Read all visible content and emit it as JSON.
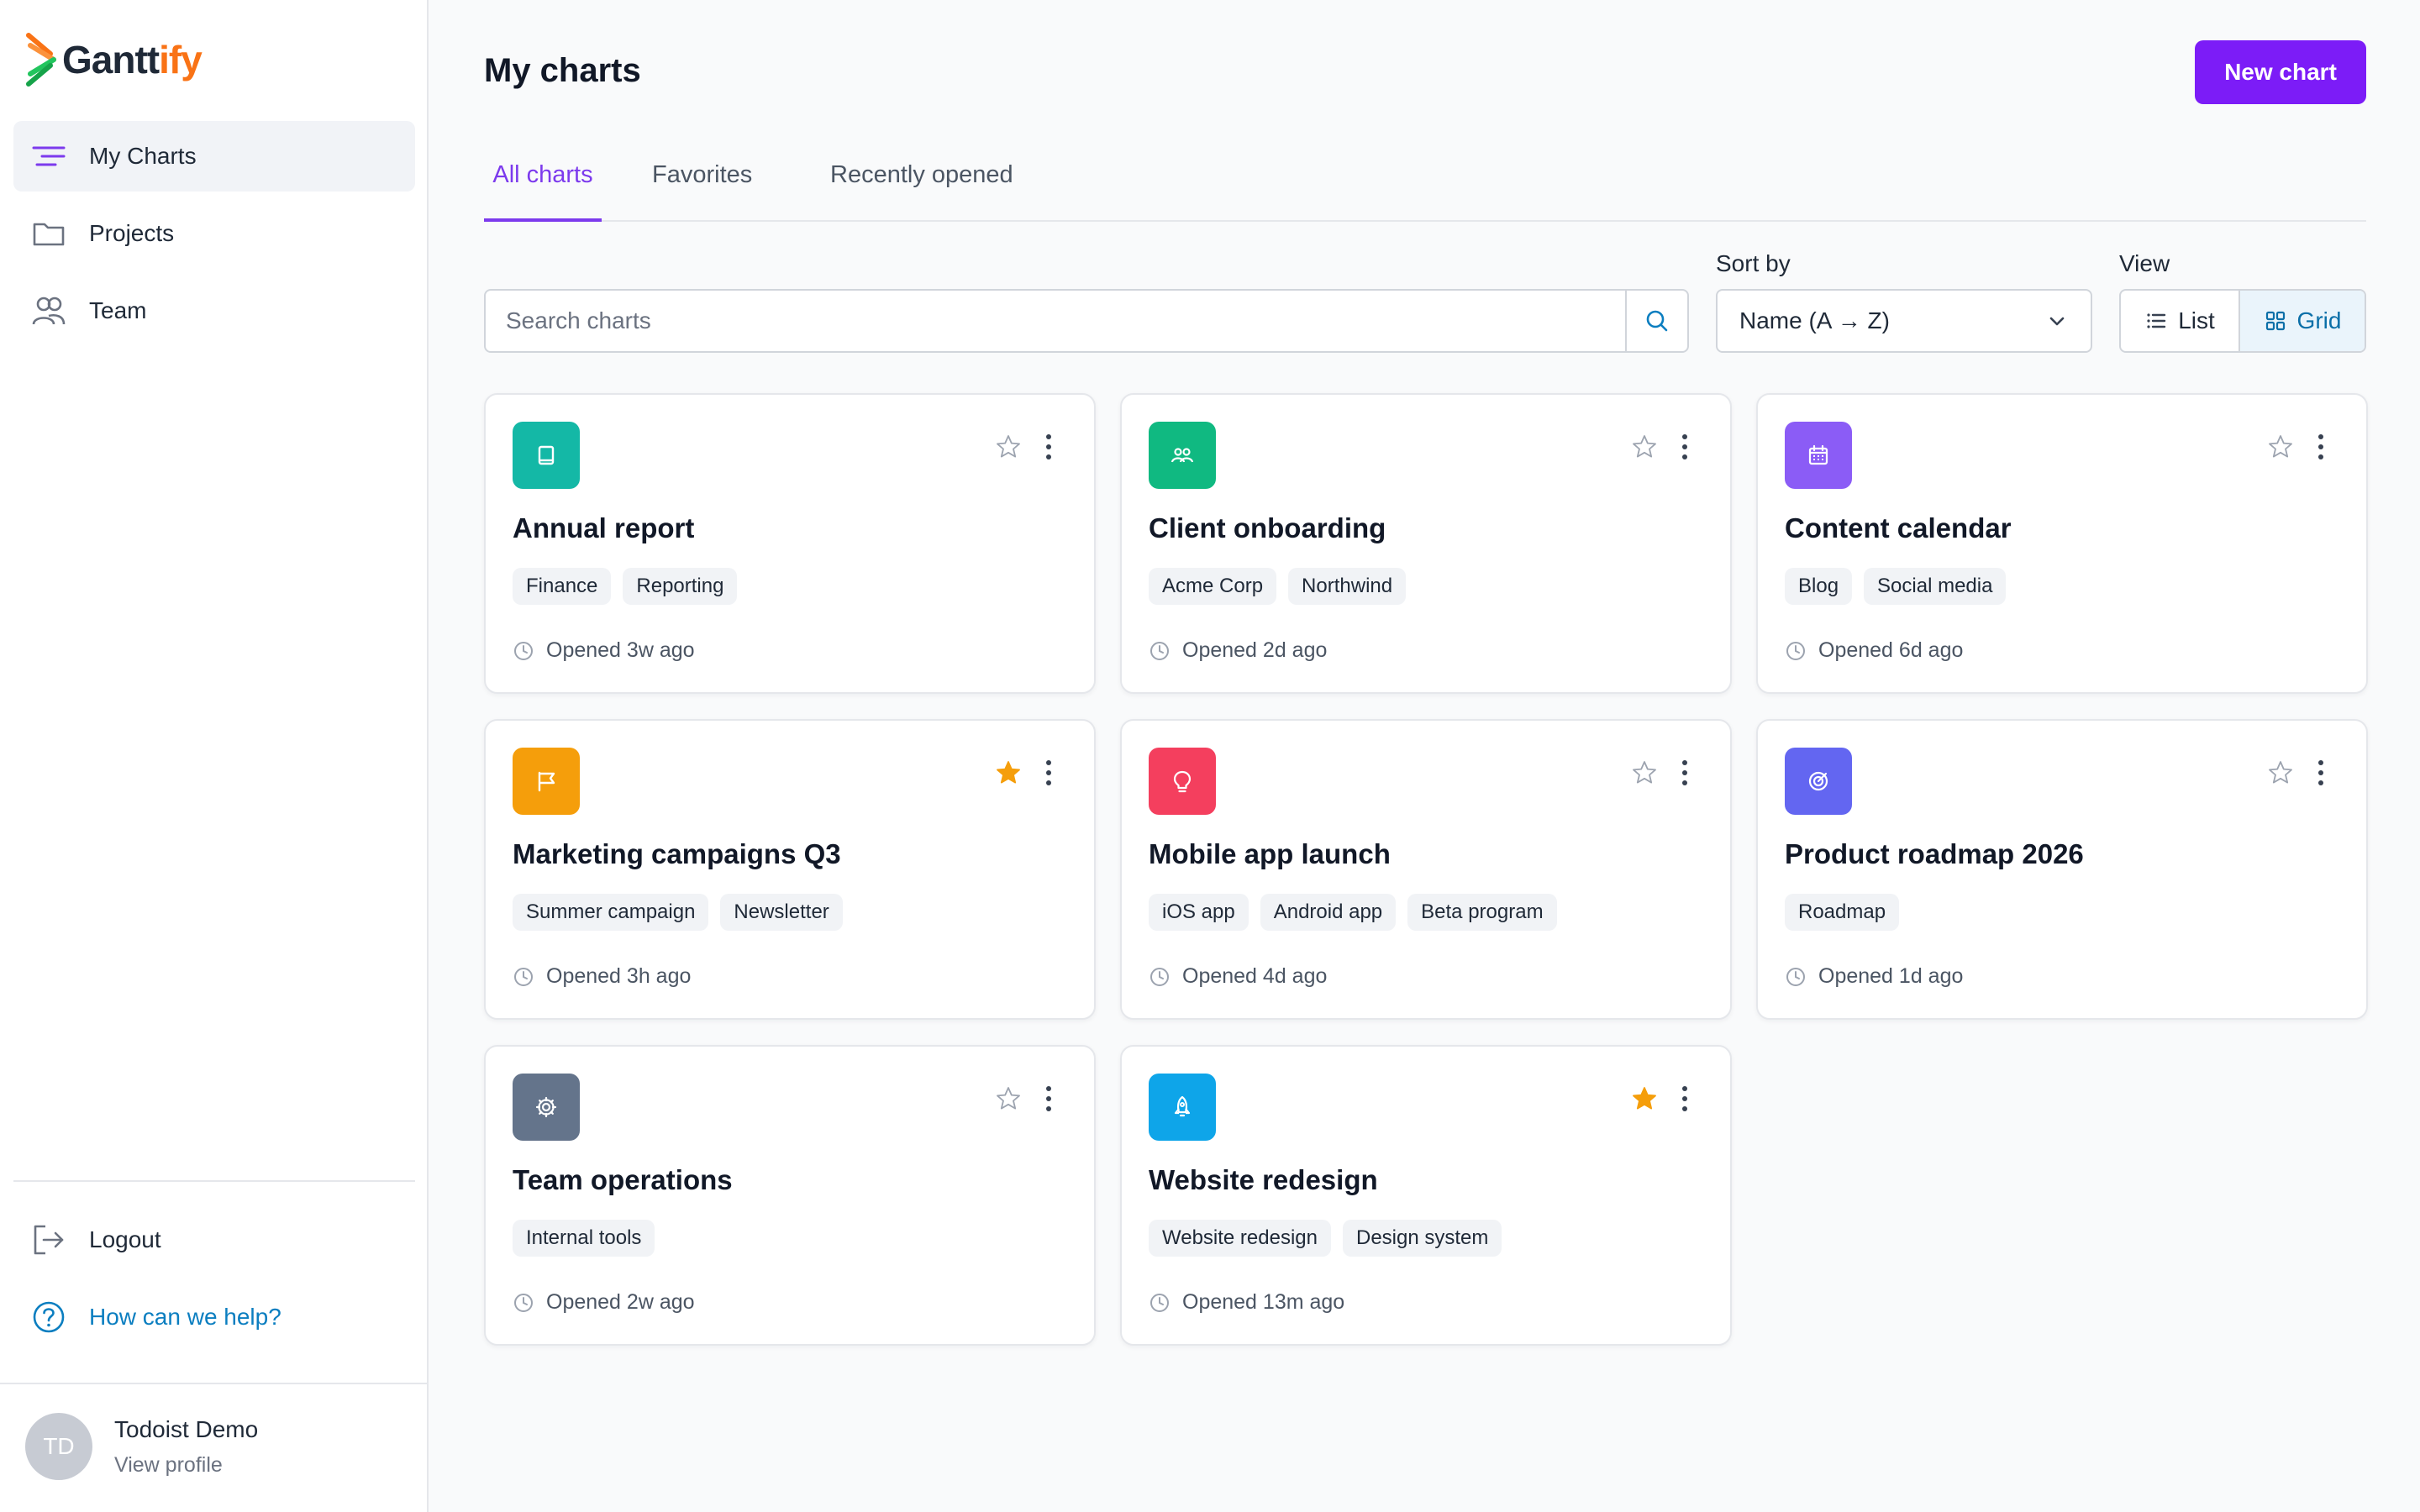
{
  "brand": {
    "name_main": "Gantt",
    "name_accent": "ify"
  },
  "sidebar": {
    "items": [
      {
        "label": "My Charts",
        "icon": "chart-lines-icon",
        "active": true
      },
      {
        "label": "Projects",
        "icon": "folder-icon"
      },
      {
        "label": "Team",
        "icon": "users-icon"
      }
    ],
    "logout_label": "Logout",
    "help_label": "How can we help?",
    "profile": {
      "initials": "TD",
      "name": "Todoist Demo",
      "link_label": "View profile"
    }
  },
  "header": {
    "title": "My charts",
    "new_chart_label": "New chart"
  },
  "tabs": [
    {
      "label": "All charts",
      "active": true
    },
    {
      "label": "Favorites"
    },
    {
      "label": "Recently opened"
    }
  ],
  "search": {
    "placeholder": "Search charts",
    "value": ""
  },
  "sort": {
    "label": "Sort by",
    "value": "Name (A → Z)"
  },
  "view": {
    "label": "View",
    "list_label": "List",
    "grid_label": "Grid",
    "selected": "Grid"
  },
  "colors": {
    "accent": "#7c1cf7",
    "link": "#0b7ec0",
    "favorite": "#f59e0b"
  },
  "cards": [
    {
      "title": "Annual report",
      "tags": [
        "Finance",
        "Reporting"
      ],
      "opened": "Opened 3w ago",
      "favorite": false,
      "icon": "book-icon",
      "color": "#14b8a6"
    },
    {
      "title": "Client onboarding",
      "tags": [
        "Acme Corp",
        "Northwind"
      ],
      "opened": "Opened 2d ago",
      "favorite": false,
      "icon": "people-icon",
      "color": "#10b981"
    },
    {
      "title": "Content calendar",
      "tags": [
        "Blog",
        "Social media"
      ],
      "opened": "Opened 6d ago",
      "favorite": false,
      "icon": "calendar-icon",
      "color": "#8b5cf6"
    },
    {
      "title": "Marketing campaigns Q3",
      "tags": [
        "Summer campaign",
        "Newsletter"
      ],
      "opened": "Opened 3h ago",
      "favorite": true,
      "icon": "flag-icon",
      "color": "#f59e0b"
    },
    {
      "title": "Mobile app launch",
      "tags": [
        "iOS app",
        "Android app",
        "Beta program"
      ],
      "opened": "Opened 4d ago",
      "favorite": false,
      "icon": "lightbulb-icon",
      "color": "#f43f5e"
    },
    {
      "title": "Product roadmap 2026",
      "tags": [
        "Roadmap"
      ],
      "opened": "Opened 1d ago",
      "favorite": false,
      "icon": "target-icon",
      "color": "#6366f1"
    },
    {
      "title": "Team operations",
      "tags": [
        "Internal tools"
      ],
      "opened": "Opened 2w ago",
      "favorite": false,
      "icon": "gear-icon",
      "color": "#64748b"
    },
    {
      "title": "Website redesign",
      "tags": [
        "Website redesign",
        "Design system"
      ],
      "opened": "Opened 13m ago",
      "favorite": true,
      "icon": "rocket-icon",
      "color": "#0ea5e9"
    }
  ]
}
